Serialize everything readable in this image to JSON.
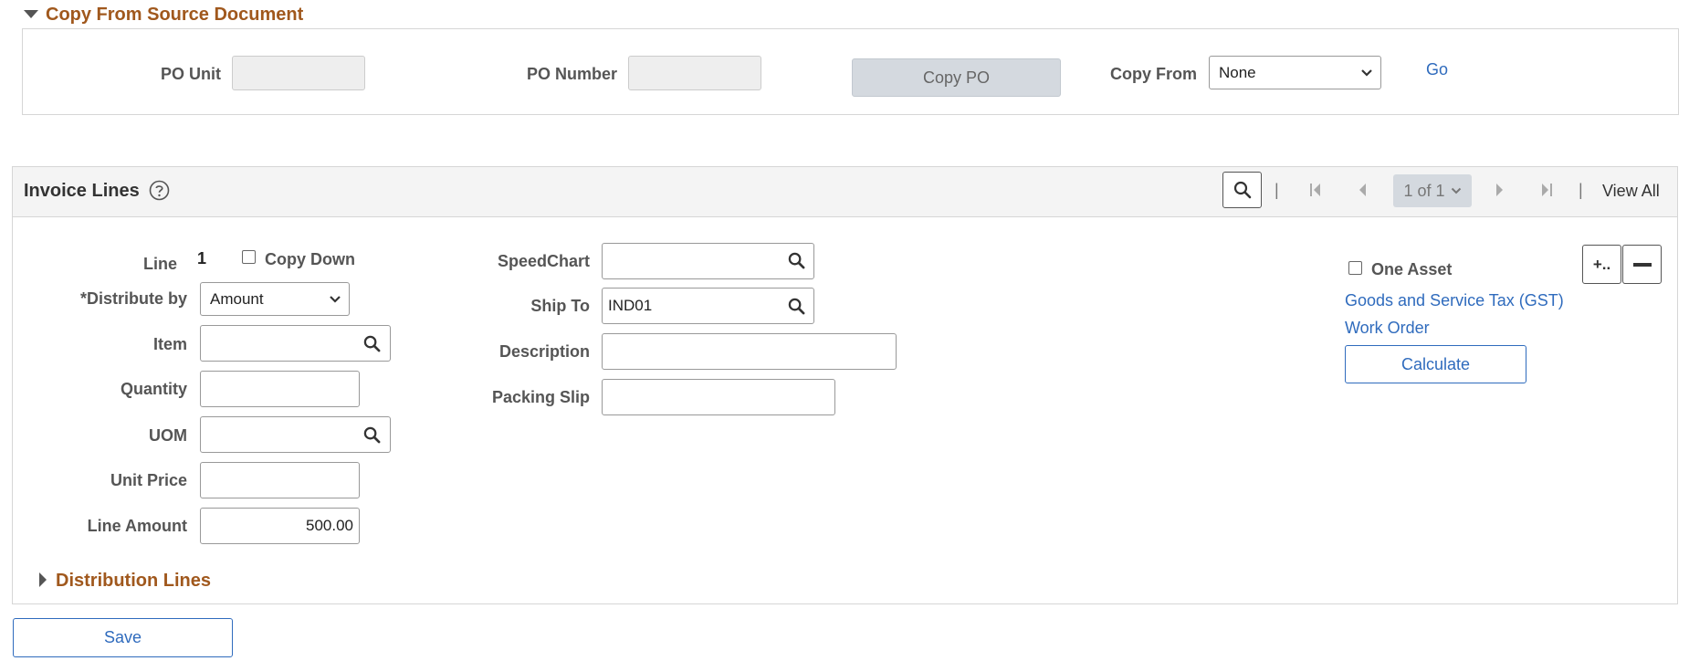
{
  "copy_section": {
    "title": "Copy From Source Document",
    "po_unit_label": "PO Unit",
    "po_unit_value": "",
    "po_number_label": "PO Number",
    "po_number_value": "",
    "copy_po_button": "Copy PO",
    "copy_from_label": "Copy From",
    "copy_from_selected": "None",
    "go_link": "Go"
  },
  "invoice_lines": {
    "title": "Invoice Lines",
    "pager": {
      "page_text": "1 of 1",
      "view_all": "View All",
      "separator": "|"
    },
    "line_label": "Line",
    "line_value": "1",
    "copy_down_label": "Copy Down",
    "distribute_by_label": "*Distribute by",
    "distribute_by_selected": "Amount",
    "item_label": "Item",
    "item_value": "",
    "quantity_label": "Quantity",
    "quantity_value": "",
    "uom_label": "UOM",
    "uom_value": "",
    "unit_price_label": "Unit Price",
    "unit_price_value": "",
    "line_amount_label": "Line Amount",
    "line_amount_value": "500.00",
    "speedchart_label": "SpeedChart",
    "speedchart_value": "",
    "ship_to_label": "Ship To",
    "ship_to_value": "IND01",
    "description_label": "Description",
    "description_value": "",
    "packing_slip_label": "Packing Slip",
    "packing_slip_value": "",
    "one_asset_label": "One Asset",
    "gst_link": "Goods and Service Tax (GST)",
    "work_order_link": "Work Order",
    "calculate_button": "Calculate",
    "add_row_glyph": "+..",
    "distribution_lines_title": "Distribution Lines"
  },
  "save_button": "Save",
  "icons": {
    "collapse": "triangle-down-icon",
    "expand": "triangle-right-icon",
    "search": "search-icon",
    "help": "help-icon",
    "first": "first-page-icon",
    "prev": "previous-page-icon",
    "next": "next-page-icon",
    "last": "last-page-icon",
    "chevron": "chevron-down-icon",
    "add_row": "add-row-icon",
    "delete_row": "delete-row-icon"
  },
  "colors": {
    "section_title": "#a0581d",
    "link": "#2f6bbd",
    "header_bg": "#f4f4f4",
    "border": "#d6d6d6"
  }
}
